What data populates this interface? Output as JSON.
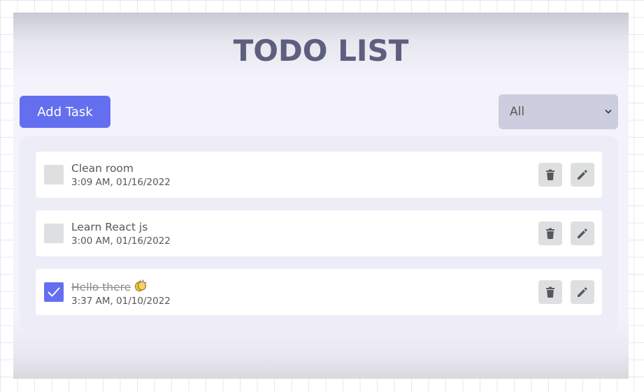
{
  "app": {
    "title": "TODO LIST"
  },
  "toolbar": {
    "add_label": "Add Task",
    "filter": {
      "selected": "All"
    }
  },
  "todos": [
    {
      "title": "Clean room",
      "time": "3:09 AM, 01/16/2022",
      "completed": false
    },
    {
      "title": "Learn React js",
      "time": "3:00 AM, 01/16/2022",
      "completed": false
    },
    {
      "title": "Hello there",
      "time": "3:37 AM, 01/10/2022",
      "completed": true,
      "emoji": "clapping-hands"
    }
  ],
  "colors": {
    "primary": "#646ff0",
    "title": "#5c5f7d",
    "filter_bg": "#cccdde",
    "panel_bg": "#ecedf6",
    "button_gray": "#dedfe1",
    "text": "#585858"
  },
  "icons": {
    "delete": "trash-icon",
    "edit": "pencil-icon",
    "check": "check-icon",
    "chevron": "chevron-down-icon"
  }
}
